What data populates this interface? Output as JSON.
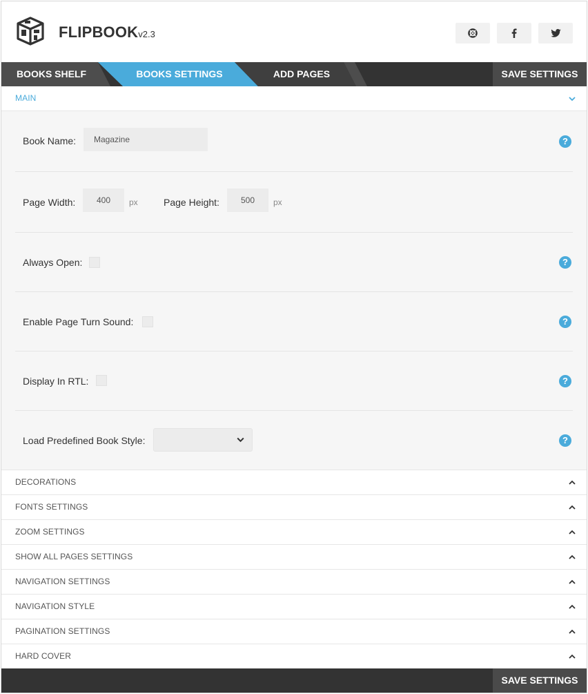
{
  "brand": {
    "title": "FLIPBOOK",
    "version": "v2.3"
  },
  "social": [
    {
      "name": "support-icon"
    },
    {
      "name": "facebook-icon"
    },
    {
      "name": "twitter-icon"
    }
  ],
  "nav": {
    "tabs": [
      {
        "label": "BOOKS SHELF",
        "active": false
      },
      {
        "label": "BOOKS SETTINGS",
        "active": true
      },
      {
        "label": "ADD PAGES",
        "active": false
      }
    ],
    "save_label": "SAVE SETTINGS"
  },
  "colors": {
    "accent": "#4aabdb",
    "dark_bar": "#333333",
    "save_bg": "#4a4a4a",
    "input_bg": "#ececec"
  },
  "main_section": {
    "label": "MAIN",
    "expanded": true,
    "book_name": {
      "label": "Book Name:",
      "value": "Magazine"
    },
    "page_width": {
      "label": "Page Width:",
      "value": "400",
      "unit": "px"
    },
    "page_height": {
      "label": "Page Height:",
      "value": "500",
      "unit": "px"
    },
    "always_open": {
      "label": "Always Open:",
      "checked": false
    },
    "page_turn_sound": {
      "label": "Enable Page Turn Sound:",
      "checked": false
    },
    "rtl": {
      "label": "Display In RTL:",
      "checked": false
    },
    "predefined_style": {
      "label": "Load Predefined Book Style:",
      "value": ""
    },
    "help_glyph": "?"
  },
  "sections": [
    {
      "label": "DECORATIONS"
    },
    {
      "label": "FONTS SETTINGS"
    },
    {
      "label": "ZOOM SETTINGS"
    },
    {
      "label": "SHOW ALL PAGES SETTINGS"
    },
    {
      "label": "NAVIGATION SETTINGS"
    },
    {
      "label": "NAVIGATION STYLE"
    },
    {
      "label": "PAGINATION SETTINGS"
    },
    {
      "label": "HARD COVER"
    }
  ],
  "bottom": {
    "save_label": "SAVE SETTINGS"
  }
}
